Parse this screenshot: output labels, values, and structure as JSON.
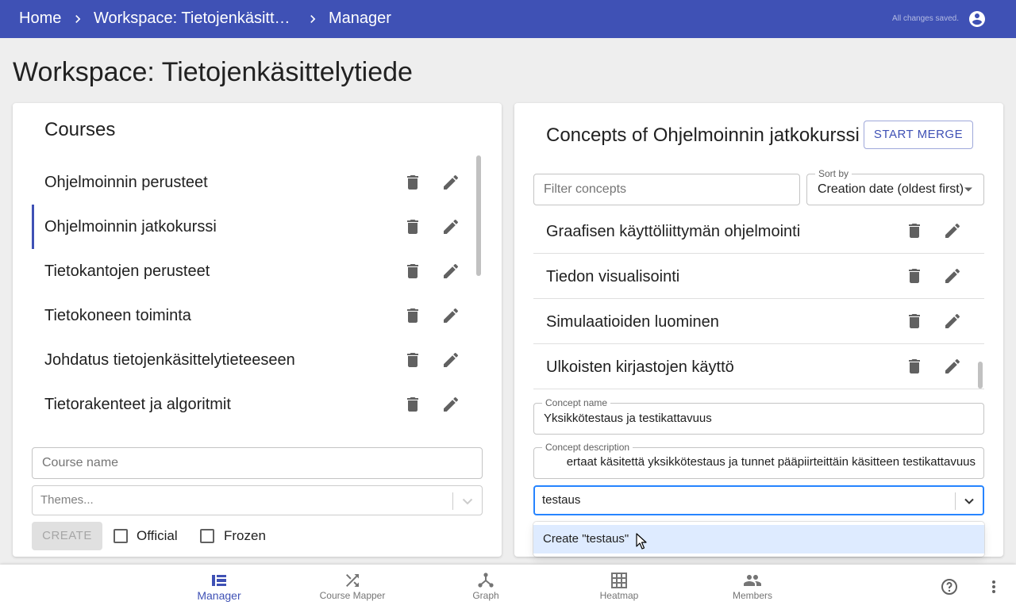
{
  "header": {
    "breadcrumbs": [
      "Home",
      "Workspace: Tietojenkäsitt…",
      "Manager"
    ],
    "save_status": "All changes saved."
  },
  "page_title": "Workspace: Tietojenkäsittelytiede",
  "courses": {
    "heading": "Courses",
    "items": [
      {
        "label": "Ohjelmoinnin perusteet",
        "selected": false
      },
      {
        "label": "Ohjelmoinnin jatkokurssi",
        "selected": true
      },
      {
        "label": "Tietokantojen perusteet",
        "selected": false
      },
      {
        "label": "Tietokoneen toiminta",
        "selected": false
      },
      {
        "label": "Johdatus tietojenkäsittelytieteeseen",
        "selected": false
      },
      {
        "label": "Tietorakenteet ja algoritmit",
        "selected": false
      }
    ],
    "course_name_placeholder": "Course name",
    "themes_placeholder": "Themes...",
    "create_label": "CREATE",
    "official_label": "Official",
    "frozen_label": "Frozen",
    "official_checked": false,
    "frozen_checked": false
  },
  "concepts": {
    "heading": "Concepts of Ohjelmoinnin jatkokurssi",
    "merge_label": "START MERGE",
    "filter_placeholder": "Filter concepts",
    "sort_label": "Sort by",
    "sort_value": "Creation date (oldest first)",
    "items": [
      "Graafisen käyttöliittymän ohjelmointi",
      "Tiedon visualisointi",
      "Simulaatioiden luominen",
      "Ulkoisten kirjastojen käyttö"
    ],
    "name_label": "Concept name",
    "name_value": "Yksikkötestaus ja testikattavuus",
    "description_label": "Concept description",
    "description_value": "ertaat käsitettä yksikkötestaus ja tunnet pääpiirteittäin käsitteen testikattavuus",
    "tag_input_value": "testaus",
    "tag_option": "Create \"testaus\""
  },
  "bottom_nav": {
    "items": [
      {
        "label": "Manager",
        "icon": "view-list-icon",
        "active": true
      },
      {
        "label": "Course Mapper",
        "icon": "shuffle-icon",
        "active": false
      },
      {
        "label": "Graph",
        "icon": "graph-icon",
        "active": false
      },
      {
        "label": "Heatmap",
        "icon": "grid-icon",
        "active": false
      },
      {
        "label": "Members",
        "icon": "people-icon",
        "active": false
      }
    ]
  },
  "colors": {
    "primary": "#3f51b5",
    "select_focus": "#2684ff",
    "option_highlight": "#deebff",
    "background": "#eeeeee"
  }
}
